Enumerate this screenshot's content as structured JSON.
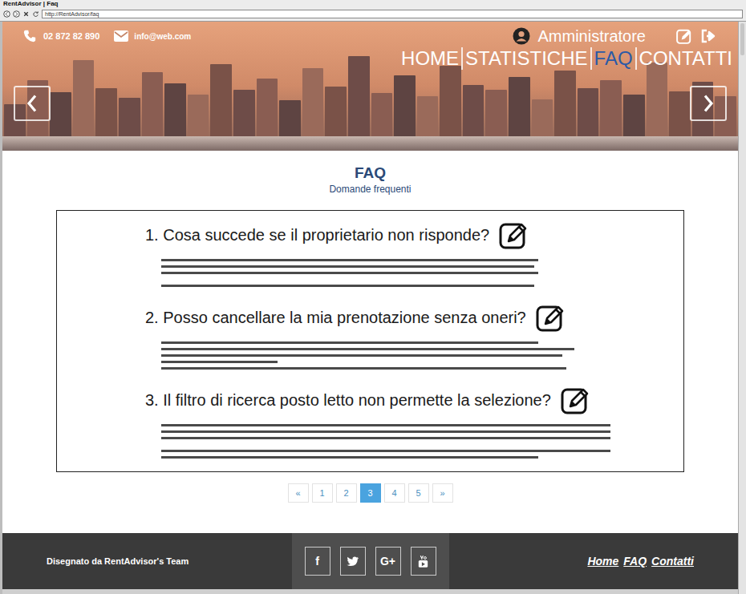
{
  "window": {
    "title": "RentAdvisor | Faq",
    "address": "http://RentAdvisor/faq"
  },
  "contact": {
    "phone": "02 872 82 890",
    "email": "info@web.com"
  },
  "user": {
    "name": "Amministratore"
  },
  "nav": [
    {
      "label": "HOME",
      "selected": false
    },
    {
      "label": "STATISTICHE",
      "selected": false
    },
    {
      "label": "FAQ",
      "selected": true
    },
    {
      "label": "CONTATTI",
      "selected": false
    }
  ],
  "page": {
    "title": "FAQ",
    "subtitle": "Domande frequenti"
  },
  "faqs": [
    {
      "question": "1. Cosa succede se il proprietario non risponde?"
    },
    {
      "question": "2. Posso cancellare la mia prenotazione senza oneri?"
    },
    {
      "question": "3. Il filtro di ricerca posto letto non permette la selezione?"
    }
  ],
  "pagination": [
    {
      "label": "«",
      "selected": false
    },
    {
      "label": "1",
      "selected": false
    },
    {
      "label": "2",
      "selected": false
    },
    {
      "label": "3",
      "selected": true
    },
    {
      "label": "4",
      "selected": false
    },
    {
      "label": "5",
      "selected": false
    },
    {
      "label": "»",
      "selected": false
    }
  ],
  "footer": {
    "credit": "Disegnato da RentAdvisor's Team",
    "social": [
      {
        "kind": "facebook",
        "label": "f"
      },
      {
        "kind": "twitter"
      },
      {
        "kind": "googleplus",
        "label": "G+"
      },
      {
        "kind": "youtube"
      }
    ],
    "links": [
      "Home",
      "FAQ",
      "Contatti"
    ]
  }
}
